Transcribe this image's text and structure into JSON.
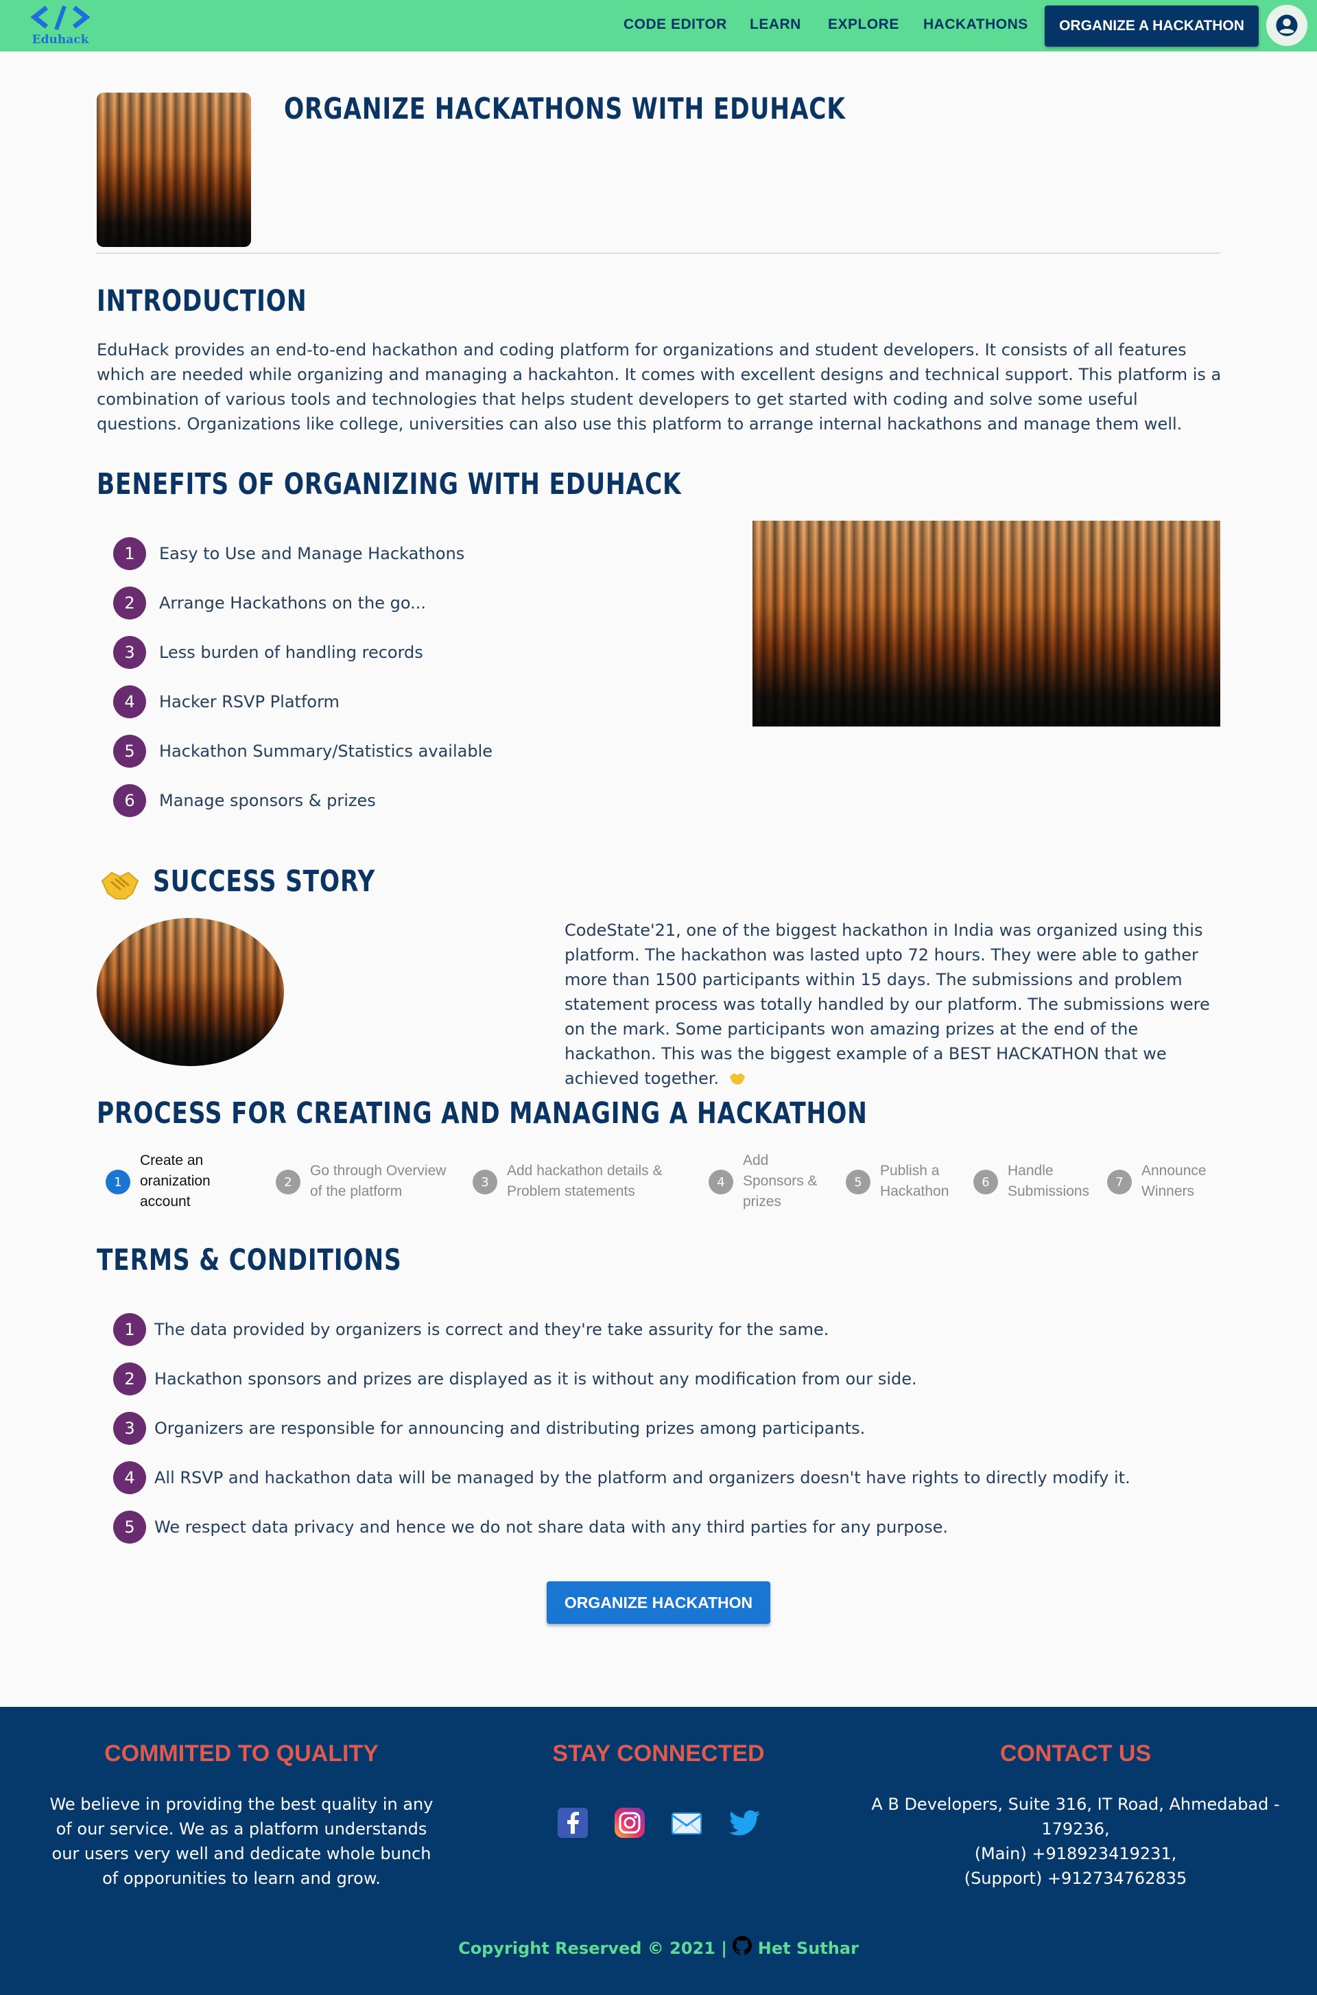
{
  "nav": {
    "logo_text": "Eduhack",
    "links": [
      "CODE EDITOR",
      "LEARN",
      "EXPLORE",
      "HACKATHONS"
    ],
    "cta": "ORGANIZE A HACKATHON"
  },
  "hero": {
    "title": "ORGANIZE HACKATHONS WITH EDUHACK"
  },
  "intro": {
    "heading": "INTRODUCTION",
    "text": "EduHack provides an end-to-end hackathon and coding platform for organizations and student developers. It consists of all features which are needed while organizing and managing a hackahton. It comes with excellent designs and technical support. This platform is a combination of various tools and technologies that helps student developers to get started with coding and solve some useful questions. Organizations like college, universities can also use this platform to arrange internal hackathons and manage them well."
  },
  "benefits": {
    "heading": "BENEFITS OF ORGANIZING WITH EDUHACK",
    "items": [
      {
        "num": "1",
        "text": "Easy to Use and Manage Hackathons"
      },
      {
        "num": "2",
        "text": "Arrange Hackathons on the go..."
      },
      {
        "num": "3",
        "text": "Less burden of handling records"
      },
      {
        "num": "4",
        "text": "Hacker RSVP Platform"
      },
      {
        "num": "5",
        "text": "Hackathon Summary/Statistics available"
      },
      {
        "num": "6",
        "text": "Manage sponsors & prizes"
      }
    ]
  },
  "success": {
    "heading": "SUCCESS STORY",
    "text": "CodeState'21, one of the biggest hackathon in India was organized using this platform. The hackathon was lasted upto 72 hours. They were able to gather more than 1500 participants within 15 days. The submissions and problem statement process was totally handled by our platform. The submissions were on the mark. Some participants won amazing prizes at the end of the hackathon. This was the biggest example of a BEST HACKATHON that we achieved together."
  },
  "process": {
    "heading": "PROCESS FOR CREATING AND MANAGING A HACKATHON",
    "steps": [
      {
        "num": "1",
        "lines": [
          "Create an",
          "oranization",
          "account"
        ]
      },
      {
        "num": "2",
        "lines": [
          "Go through Overview",
          "of the platform"
        ]
      },
      {
        "num": "3",
        "lines": [
          "Add hackathon details &",
          "Problem statements"
        ]
      },
      {
        "num": "4",
        "lines": [
          "Add",
          "Sponsors &",
          "prizes"
        ]
      },
      {
        "num": "5",
        "lines": [
          "Publish a",
          "Hackathon"
        ]
      },
      {
        "num": "6",
        "lines": [
          "Handle",
          "Submissions"
        ]
      },
      {
        "num": "7",
        "lines": [
          "Announce",
          "Winners"
        ]
      }
    ]
  },
  "terms": {
    "heading": "TERMS & CONDITIONS",
    "items": [
      {
        "num": "1",
        "text": "The data provided by organizers is correct and they're take assurity for the same."
      },
      {
        "num": "2",
        "text": "Hackathon sponsors and prizes are displayed as it is without any modification from our side."
      },
      {
        "num": "3",
        "text": "Organizers are responsible for announcing and distributing prizes among participants."
      },
      {
        "num": "4",
        "text": "All RSVP and hackathon data will be managed by the platform and organizers doesn't have rights to directly modify it."
      },
      {
        "num": "5",
        "text": "We respect data privacy and hence we do not share data with any third parties for any purpose."
      }
    ]
  },
  "cta": "ORGANIZE HACKATHON",
  "footer": {
    "quality_heading": "COMMITED TO QUALITY",
    "quality_text": "We believe in providing the best quality in any of our service. We as a platform understands our users very well and dedicate whole bunch of opporunities to learn and grow.",
    "connected_heading": "STAY CONNECTED",
    "social": [
      "facebook-icon",
      "instagram-icon",
      "mail-icon",
      "twitter-icon"
    ],
    "contact_heading": "CONTACT US",
    "address": "A B Developers, Suite 316, IT Road, Ahmedabad - 179236,",
    "main_phone": "(Main) +918923419231,",
    "support_phone": "(Support) +912734762835",
    "copyright": "Copyright Reserved © 2021 |",
    "author": "Het Suthar"
  },
  "colors": {
    "nav_bg": "#5cdb95",
    "navy": "#05386b",
    "purple": "#6a2c70",
    "blue": "#1976d2",
    "footer_heading": "#e05a4e"
  }
}
